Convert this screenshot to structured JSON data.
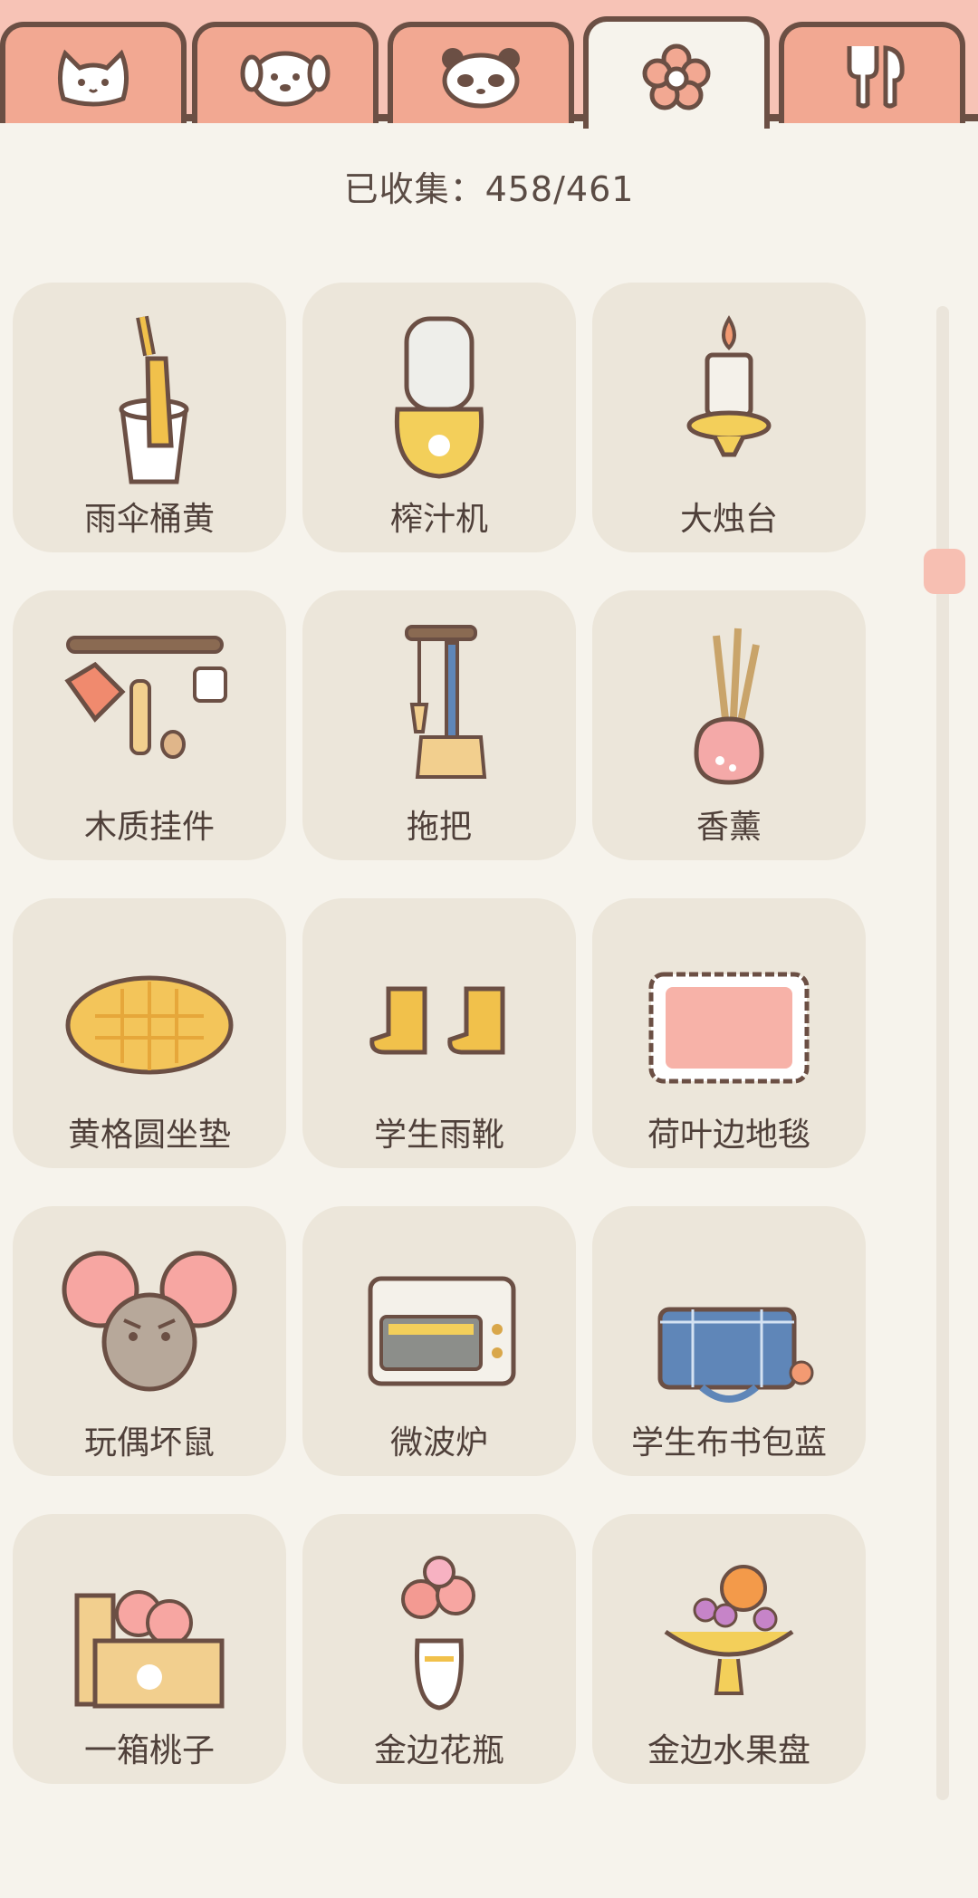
{
  "tabs": [
    {
      "icon": "cat-face-icon",
      "active": false
    },
    {
      "icon": "dog-face-icon",
      "active": false
    },
    {
      "icon": "panda-face-icon",
      "active": false
    },
    {
      "icon": "flower-icon",
      "active": true
    },
    {
      "icon": "utensils-icon",
      "active": false
    }
  ],
  "collection": {
    "status": "已收集：458/461"
  },
  "items": [
    {
      "label": "雨伞桶黄",
      "icon": "umbrella-bucket-icon"
    },
    {
      "label": "榨汁机",
      "icon": "juicer-icon"
    },
    {
      "label": "大烛台",
      "icon": "candle-holder-icon"
    },
    {
      "label": "木质挂件",
      "icon": "wooden-hanger-icon"
    },
    {
      "label": "拖把",
      "icon": "mop-icon"
    },
    {
      "label": "香薰",
      "icon": "incense-icon"
    },
    {
      "label": "黄格圆坐垫",
      "icon": "round-cushion-icon"
    },
    {
      "label": "学生雨靴",
      "icon": "rain-boots-icon"
    },
    {
      "label": "荷叶边地毯",
      "icon": "ruffled-rug-icon"
    },
    {
      "label": "玩偶坏鼠",
      "icon": "mouse-doll-icon"
    },
    {
      "label": "微波炉",
      "icon": "microwave-icon"
    },
    {
      "label": "学生布书包蓝",
      "icon": "school-bag-icon"
    },
    {
      "label": "一箱桃子",
      "icon": "peach-box-icon"
    },
    {
      "label": "金边花瓶",
      "icon": "flower-vase-icon"
    },
    {
      "label": "金边水果盘",
      "icon": "fruit-plate-icon"
    }
  ],
  "colors": {
    "background": "#f6f3ec",
    "tab_inactive": "#f2a892",
    "outline": "#6b4f44",
    "card": "#ece6da",
    "scroll_thumb": "#f7bfb2"
  }
}
